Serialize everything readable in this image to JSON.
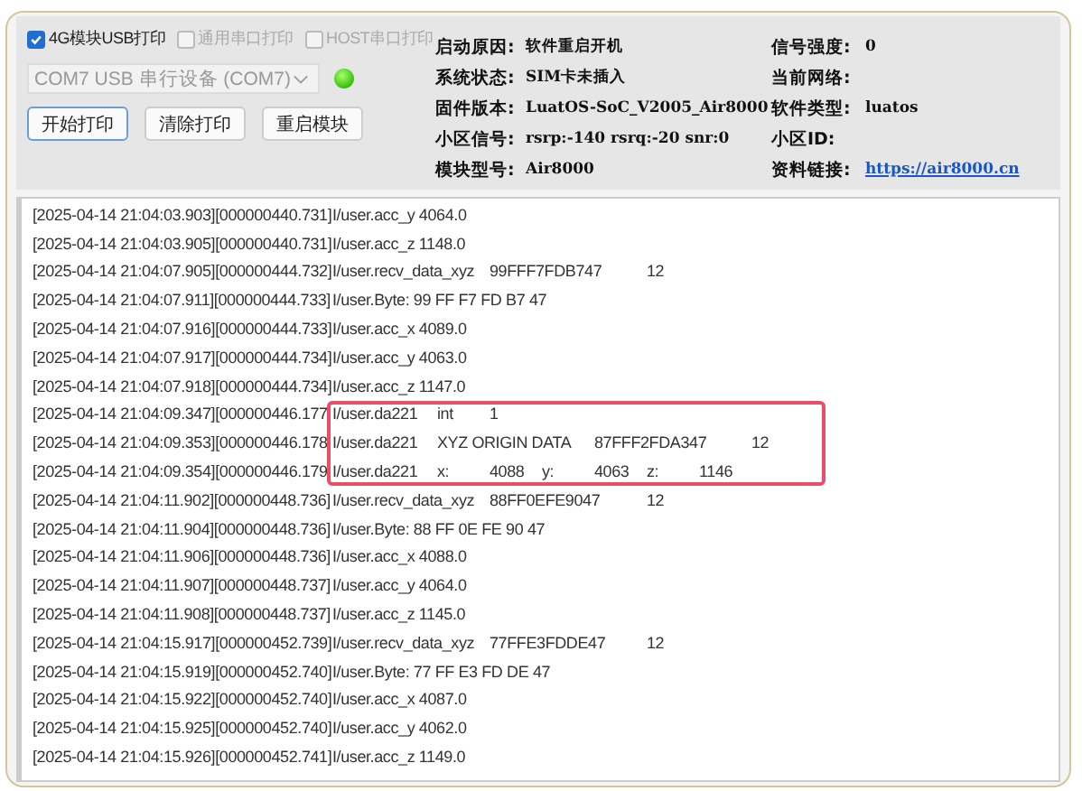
{
  "options": [
    {
      "label": "4G模块USB打印",
      "checked": true,
      "disabled": false
    },
    {
      "label": "通用串口打印",
      "checked": false,
      "disabled": true
    },
    {
      "label": "HOST串口打印",
      "checked": false,
      "disabled": true
    }
  ],
  "port": {
    "value": "COM7 USB 串行设备 (COM7)",
    "connected": true
  },
  "buttons": [
    {
      "label": "开始打印",
      "selected": true
    },
    {
      "label": "清除打印",
      "selected": false
    },
    {
      "label": "重启模块",
      "selected": false
    }
  ],
  "info": [
    {
      "label": "启动原因:",
      "value": "软件重启开机",
      "kind": "text"
    },
    {
      "label": "信号强度:",
      "value": "0",
      "kind": "text"
    },
    {
      "label": "系统状态:",
      "value": "SIM卡未插入",
      "kind": "text"
    },
    {
      "label": "当前网络:",
      "kind": "text"
    },
    {
      "label": "固件版本:",
      "value": "LuatOS-SoC_V2005_Air8000",
      "kind": "text"
    },
    {
      "label": "软件类型:",
      "value": "luatos",
      "kind": "text"
    },
    {
      "label": "小区信号:",
      "value": "rsrp:-140 rsrq:-20 snr:0",
      "kind": "text"
    },
    {
      "label": "小区ID:",
      "kind": "text"
    },
    {
      "label": "模块型号:",
      "value": "Air8000",
      "kind": "text"
    },
    {
      "label": "资料链接:",
      "value": "https://air8000.cn",
      "kind": "link"
    }
  ],
  "log": [
    {
      "kind": "line",
      "time": "[2025-04-14 21:04:03.903][000000440.731]",
      "message": "I/user.acc_y 4064.0"
    },
    {
      "kind": "line",
      "time": "[2025-04-14 21:04:03.905][000000440.731]",
      "message": "I/user.acc_z 1148.0"
    },
    {
      "kind": "line",
      "time": "[2025-04-14 21:04:07.905][000000444.732]",
      "message": "I/user.recv_data_xyz\t99FFF7FDB747\t12"
    },
    {
      "kind": "line",
      "time": "[2025-04-14 21:04:07.911][000000444.733]",
      "message": "I/user.Byte: 99 FF F7 FD B7 47"
    },
    {
      "kind": "line",
      "time": "[2025-04-14 21:04:07.916][000000444.733]",
      "message": "I/user.acc_x 4089.0"
    },
    {
      "kind": "line",
      "time": "[2025-04-14 21:04:07.917][000000444.734]",
      "message": "I/user.acc_y 4063.0"
    },
    {
      "kind": "line",
      "time": "[2025-04-14 21:04:07.918][000000444.734]",
      "message": "I/user.acc_z 1147.0"
    },
    {
      "kind": "highlight",
      "lines": [
        {
          "time": "[2025-04-14 21:04:09.347][000000446.177",
          "message": "I/user.da221\tint\t1"
        },
        {
          "time": "[2025-04-14 21:04:09.353][000000446.178",
          "message": "I/user.da221\tXYZ ORIGIN DATA\t87FFF2FDA347\t12"
        },
        {
          "time": "[2025-04-14 21:04:09.354][000000446.179",
          "message": "I/user.da221\tx:\t4088\ty:\t4063\tz:\t1146"
        }
      ]
    },
    {
      "kind": "line",
      "time": "[2025-04-14 21:04:11.902][000000448.736]",
      "message": "I/user.recv_data_xyz\t88FF0EFE9047\t12"
    },
    {
      "kind": "line",
      "time": "[2025-04-14 21:04:11.904][000000448.736]",
      "message": "I/user.Byte: 88 FF 0E FE 90 47"
    },
    {
      "kind": "line",
      "time": "[2025-04-14 21:04:11.906][000000448.736]",
      "message": "I/user.acc_x 4088.0"
    },
    {
      "kind": "line",
      "time": "[2025-04-14 21:04:11.907][000000448.737]",
      "message": "I/user.acc_y 4064.0"
    },
    {
      "kind": "line",
      "time": "[2025-04-14 21:04:11.908][000000448.737]",
      "message": "I/user.acc_z 1145.0"
    },
    {
      "kind": "line",
      "time": "[2025-04-14 21:04:15.917][000000452.739]",
      "message": "I/user.recv_data_xyz\t77FFE3FDDE47\t12"
    },
    {
      "kind": "line",
      "time": "[2025-04-14 21:04:15.919][000000452.740]",
      "message": "I/user.Byte: 77 FF E3 FD DE 47"
    },
    {
      "kind": "line",
      "time": "[2025-04-14 21:04:15.922][000000452.740]",
      "message": "I/user.acc_x 4087.0"
    },
    {
      "kind": "line",
      "time": "[2025-04-14 21:04:15.925][000000452.740]",
      "message": "I/user.acc_y 4062.0"
    },
    {
      "kind": "line",
      "time": "[2025-04-14 21:04:15.926][000000452.741]",
      "message": "I/user.acc_z 1149.0"
    }
  ]
}
